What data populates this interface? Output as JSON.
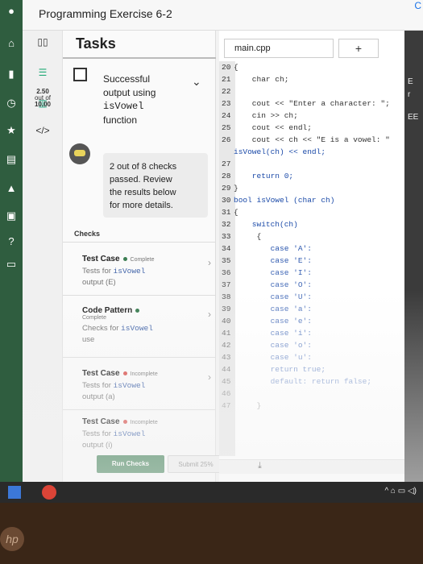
{
  "app": {
    "title": "Programming Exercise 6-2",
    "top_right_glyph": "C"
  },
  "left_rail": {
    "icons": [
      "user-icon",
      "home-icon",
      "bookmark-icon",
      "clock-icon",
      "star-icon",
      "book-icon",
      "graduation-icon",
      "briefcase-icon",
      "help-icon",
      "chat-icon"
    ]
  },
  "tasks": {
    "title": "Tasks",
    "strip": {
      "list_icon": "list-icon",
      "score": "2.50",
      "score_out_of": "out of",
      "score_max": "10.00",
      "code_icon": "</>"
    },
    "task": {
      "name_line1": "Successful",
      "name_line2": "output using",
      "name_mono": "isVowel",
      "name_line4": "function"
    },
    "callout": {
      "line1": "2 out of 8 checks",
      "line2": "passed. Review",
      "line3": "the results below",
      "line4": "for more details."
    },
    "checks_label": "Checks",
    "checks": [
      {
        "title": "Test Case",
        "status": "Complete",
        "dot_color": "#3b7d52",
        "sub_text": "Tests for ",
        "sub_mono": "isVowel",
        "sub_tail": "output (E)"
      },
      {
        "title": "Code Pattern",
        "status": "Complete",
        "dot_color": "#3b7d52",
        "sub_text": "Checks for ",
        "sub_mono": "isVowel",
        "sub_tail": "use"
      },
      {
        "title": "Test Case",
        "status": "Incomplete",
        "dot_color": "#d9534f",
        "sub_text": "Tests for ",
        "sub_mono": "isVowel",
        "sub_tail": "output (a)"
      },
      {
        "title": "Test Case",
        "status": "Incomplete",
        "dot_color": "#d9534f",
        "sub_text": "Tests for ",
        "sub_mono": "isVowel",
        "sub_tail": "output (i)"
      }
    ],
    "run_button": "Run Checks",
    "submit_button": "Submit 25%"
  },
  "editor": {
    "file_tab": "main.cpp",
    "add_tab": "+",
    "lines": [
      {
        "n": "20",
        "code": "{"
      },
      {
        "n": "21",
        "code": "    char ch;"
      },
      {
        "n": "22",
        "code": ""
      },
      {
        "n": "23",
        "code": "    cout << \"Enter a character: \";"
      },
      {
        "n": "24",
        "code": "    cin >> ch;"
      },
      {
        "n": "25",
        "code": "    cout << endl;"
      },
      {
        "n": "26",
        "code": "    cout << ch << \"E is a vowel: \""
      },
      {
        "n": "",
        "code": "isVowel(ch) << endl;"
      },
      {
        "n": "27",
        "code": ""
      },
      {
        "n": "28",
        "code": "    return 0;"
      },
      {
        "n": "29",
        "code": "}"
      },
      {
        "n": "30",
        "code": "bool isVowel (char ch)"
      },
      {
        "n": "31",
        "code": "{"
      },
      {
        "n": "32",
        "code": "    switch(ch)"
      },
      {
        "n": "33",
        "code": "     {"
      },
      {
        "n": "34",
        "code": "        case 'A':"
      },
      {
        "n": "35",
        "code": "        case 'E':"
      },
      {
        "n": "36",
        "code": "        case 'I':"
      },
      {
        "n": "37",
        "code": "        case 'O':"
      },
      {
        "n": "38",
        "code": "        case 'U':"
      },
      {
        "n": "39",
        "code": "        case 'a':"
      },
      {
        "n": "40",
        "code": "        case 'e':"
      },
      {
        "n": "41",
        "code": "        case 'i':"
      },
      {
        "n": "42",
        "code": "        case 'o':"
      },
      {
        "n": "43",
        "code": "        case 'u':"
      },
      {
        "n": "44",
        "code": "        return true;"
      },
      {
        "n": "45",
        "code": "        default: return false;"
      },
      {
        "n": "46",
        "code": ""
      },
      {
        "n": "47",
        "code": "     }"
      }
    ],
    "download_icon": "download-icon"
  },
  "right_strip": {
    "items": [
      "E",
      "r",
      "EE"
    ]
  },
  "taskbar": {
    "tray": "^ ⌂ ▭ ◁)"
  },
  "bezel": {
    "logo": "hp"
  }
}
